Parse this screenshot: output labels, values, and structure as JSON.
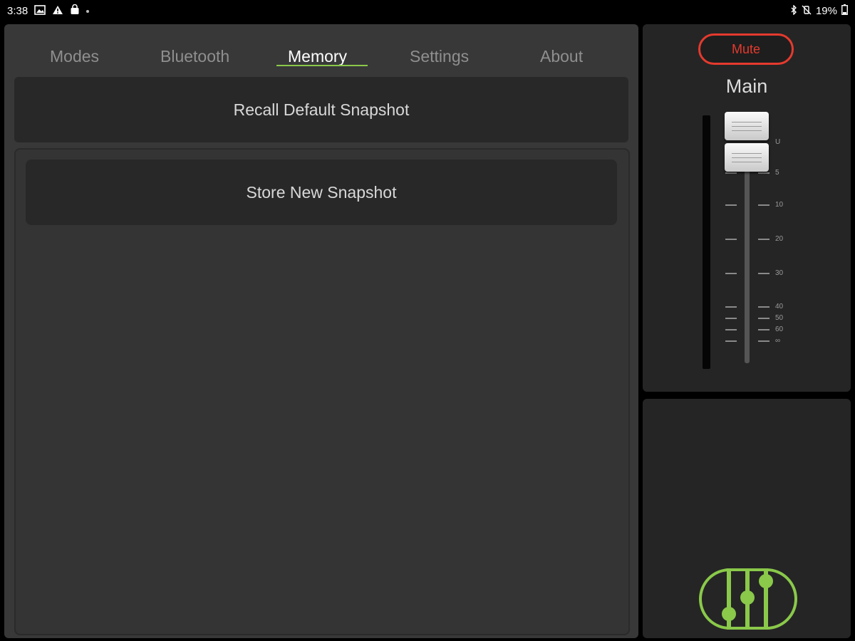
{
  "status_bar": {
    "time": "3:38",
    "battery": "19%",
    "icons": [
      "image-icon",
      "warning-icon",
      "shopping-bag-icon",
      "dot-icon",
      "bluetooth-icon",
      "mute-vibrate-icon",
      "battery-icon"
    ]
  },
  "tabs": [
    {
      "label": "Modes"
    },
    {
      "label": "Bluetooth"
    },
    {
      "label": "Memory"
    },
    {
      "label": "Settings"
    },
    {
      "label": "About"
    }
  ],
  "active_tab": "Memory",
  "memory": {
    "recall_label": "Recall Default Snapshot",
    "store_label": "Store New Snapshot"
  },
  "fader": {
    "mute_label": "Mute",
    "channel_name": "Main",
    "scale_labels": [
      "U",
      "5",
      "10",
      "20",
      "30",
      "40",
      "50",
      "60",
      "∞"
    ]
  },
  "colors": {
    "accent_green": "#8ac94a",
    "mute_red": "#e53a2e"
  }
}
